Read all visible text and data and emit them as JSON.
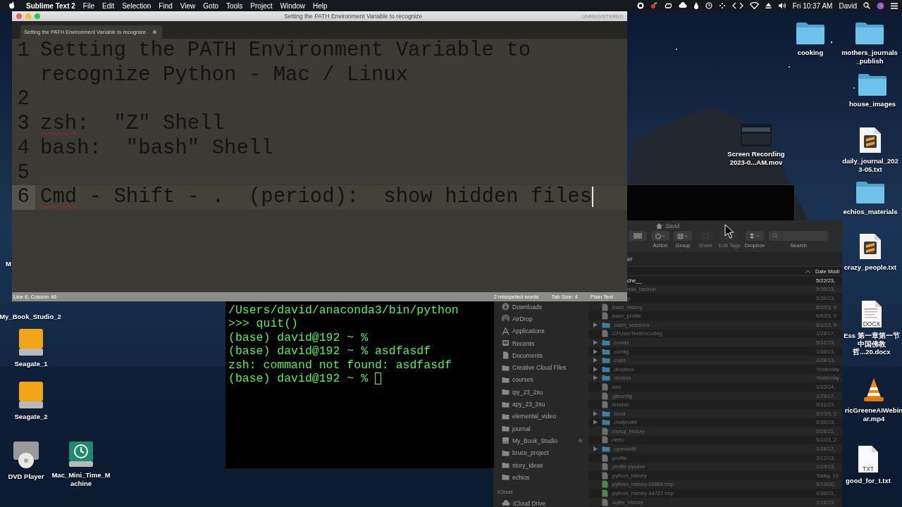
{
  "menu_bar": {
    "app_name": "Sublime Text 2",
    "menus": [
      "File",
      "Edit",
      "Selection",
      "Find",
      "View",
      "Goto",
      "Tools",
      "Project",
      "Window",
      "Help"
    ],
    "clock": "Fri 10:37 AM",
    "user": "David"
  },
  "editor_window": {
    "title": "Setting the PATH Environment Variable to recognize",
    "registration": "UNREGISTERED",
    "tab": {
      "label": "Setting the PATH Environment Variable to recognize",
      "modified": true
    },
    "lines": [
      {
        "number": "1",
        "current": false,
        "segments": [
          {
            "text": "Setting the PATH Environment Variable to recognize Python - Mac / Linux",
            "misspelled": false
          }
        ]
      },
      {
        "number": "2",
        "current": false
      },
      {
        "number": "3",
        "current": false,
        "segments": [
          {
            "text": "zsh",
            "misspelled": true
          },
          {
            "text": ":  \"Z\" Shell",
            "misspelled": false
          }
        ]
      },
      {
        "number": "4",
        "current": false,
        "segments": [
          {
            "text": "bash:  \"bash\" Shell",
            "misspelled": false
          }
        ]
      },
      {
        "number": "5",
        "current": false
      },
      {
        "number": "6",
        "current": true,
        "segments": [
          {
            "text": "Cmd",
            "misspelled": true
          },
          {
            "text": " - Shift - .  (period):  show hidden files",
            "misspelled": false
          }
        ]
      }
    ],
    "status": {
      "position": "Line 6, Column 46",
      "spelling": "2 misspelled words",
      "tab_size": "Tab Size: 4",
      "syntax": "Plain Text"
    }
  },
  "terminal": {
    "cursor": true,
    "lines": [
      "/Users/david/anaconda3/bin/python",
      ">>> quit()",
      "(base) david@192 ~ %",
      "(base) david@192 ~ % asdfasdf",
      "zsh: command not found: asdfasdf",
      "(base) david@192 ~ %"
    ]
  },
  "finder": {
    "title": "david",
    "path": "er",
    "toolbar": [
      {
        "kind": "view",
        "disabled": false
      },
      {
        "kind": "action",
        "label": "Action",
        "disabled": false
      },
      {
        "kind": "group",
        "label": "Group",
        "disabled": false
      },
      {
        "kind": "share",
        "label": "Share",
        "disabled": true
      },
      {
        "kind": "tags",
        "label": "Edit Tags",
        "disabled": true
      },
      {
        "kind": "dropbox",
        "label": "Dropbox",
        "disabled": false
      },
      {
        "kind": "search",
        "label": "Search",
        "disabled": false
      }
    ],
    "date_column": "Date Modi",
    "sidebar": [
      {
        "kind": "downloads",
        "label": "Downloads"
      },
      {
        "kind": "airdrop",
        "label": "AirDrop"
      },
      {
        "kind": "applications",
        "label": "Applications"
      },
      {
        "kind": "recents",
        "label": "Recents"
      },
      {
        "kind": "documents",
        "label": "Documents"
      },
      {
        "kind": "folder",
        "label": "Creative Cloud Files"
      },
      {
        "kind": "folder",
        "label": "courses"
      },
      {
        "kind": "folder",
        "label": "ipy_23_2su"
      },
      {
        "kind": "folder",
        "label": "apy_23_2su"
      },
      {
        "kind": "folder",
        "label": "elemental_video"
      },
      {
        "kind": "folder",
        "label": "journal"
      },
      {
        "kind": "drive",
        "label": "My_Book_Studio"
      },
      {
        "kind": "folder",
        "label": "bruce_project"
      },
      {
        "kind": "folder",
        "label": "story_ideas"
      },
      {
        "kind": "folder",
        "label": "echios"
      },
      {
        "kind": "section",
        "label": "iCloud"
      },
      {
        "kind": "cloud",
        "label": "iCloud Drive"
      }
    ],
    "rows": [
      {
        "kind": "cut",
        "name": "che__",
        "date": "5/22/23,",
        "hidden": false
      },
      {
        "kind": "cut",
        "name": "nda_backup",
        "date": "5/30/23,",
        "hidden": true
      },
      {
        "kind": "cut",
        "name": "y",
        "date": "5/30/23,",
        "hidden": true
      },
      {
        "kind": "file",
        "name": ".bash_history",
        "date": "6/3/23, 9",
        "hidden": true
      },
      {
        "kind": "file",
        "name": ".bash_profile",
        "date": "6/6/23, 9",
        "hidden": true
      },
      {
        "kind": "folder",
        "name": ".bash_sessions",
        "date": "6/3/23, 9",
        "hidden": true
      },
      {
        "kind": "file",
        "name": ".CFUserTextEncoding",
        "date": "1/28/17,",
        "hidden": true
      },
      {
        "kind": "folder",
        "name": ".conda",
        "date": "5/31/23,",
        "hidden": true
      },
      {
        "kind": "folder",
        "name": ".config",
        "date": "1/30/23,",
        "hidden": true
      },
      {
        "kind": "folder",
        "name": ".cups",
        "date": "2/28/13,",
        "hidden": true
      },
      {
        "kind": "folder",
        "name": ".dropbox",
        "date": "Yesterday",
        "hidden": true
      },
      {
        "kind": "folder",
        "name": ".dvdcss",
        "date": "Yesterday",
        "hidden": true
      },
      {
        "kind": "file",
        "name": ".eno",
        "date": "1/10/14,",
        "hidden": true
      },
      {
        "kind": "file",
        "name": ".gitconfig",
        "date": "1/29/17,",
        "hidden": true
      },
      {
        "kind": "file",
        "name": ".lesshst",
        "date": "5/31/23,",
        "hidden": true
      },
      {
        "kind": "folder",
        "name": ".local",
        "date": "5/2/23, 2",
        "hidden": true
      },
      {
        "kind": "folder",
        "name": ".matplotlib",
        "date": "5/30/23,",
        "hidden": true
      },
      {
        "kind": "file",
        "name": ".mysql_history",
        "date": "5/26/21,",
        "hidden": true
      },
      {
        "kind": "file",
        "name": ".netrc",
        "date": "5/2/23, 2",
        "hidden": true
      },
      {
        "kind": "folder",
        "name": ".openshift",
        "date": "1/28/17,",
        "hidden": true
      },
      {
        "kind": "file",
        "name": ".profile",
        "date": "3/12/13,",
        "hidden": true
      },
      {
        "kind": "file",
        "name": ".profile.pysave",
        "date": "2/24/13,",
        "hidden": true
      },
      {
        "kind": "file",
        "name": ".python_history",
        "date": "Today, 10",
        "hidden": true
      },
      {
        "kind": "tmp",
        "name": ".python_history-00868.tmp",
        "date": "5/13/20,",
        "hidden": true
      },
      {
        "kind": "tmp",
        "name": ".python_history-44727.tmp",
        "date": "4/30/21,",
        "hidden": true
      },
      {
        "kind": "file",
        "name": ".sqlite_history",
        "date": "1/26/23,",
        "hidden": true
      }
    ]
  },
  "desktop_icons": [
    {
      "kind": "folder",
      "label": "cooking"
    },
    {
      "kind": "folder",
      "label": "mothers_journals_publish"
    },
    {
      "kind": "folder",
      "label": "house_images"
    },
    {
      "kind": "video",
      "label": "Screen Recording 2023-0...AM.mov"
    },
    {
      "kind": "sublime",
      "label": "daily_journal_2023-05.txt"
    },
    {
      "kind": "folder",
      "label": "echios_materials"
    },
    {
      "kind": "sublime",
      "label": "crazy_people.txt"
    },
    {
      "kind": "docx",
      "label": "Ess 第一章第一节中国佛教哲...20.docx",
      "badge": "DOCX"
    },
    {
      "kind": "vlc",
      "label": "ricGreeneAIWebinar.mp4"
    },
    {
      "kind": "txt",
      "label": "good_for_t.txt",
      "badge": "TXT"
    },
    {
      "kind": "label",
      "label": "My_Book_Studio_2"
    },
    {
      "kind": "drive",
      "label": "Seagate_1"
    },
    {
      "kind": "drive",
      "label": "Seagate_2"
    },
    {
      "kind": "dvd",
      "label": "DVD Player"
    },
    {
      "kind": "timemachine",
      "label": "Mac_Mini_Time_Machine"
    },
    {
      "kind": "label",
      "label": "M"
    }
  ]
}
